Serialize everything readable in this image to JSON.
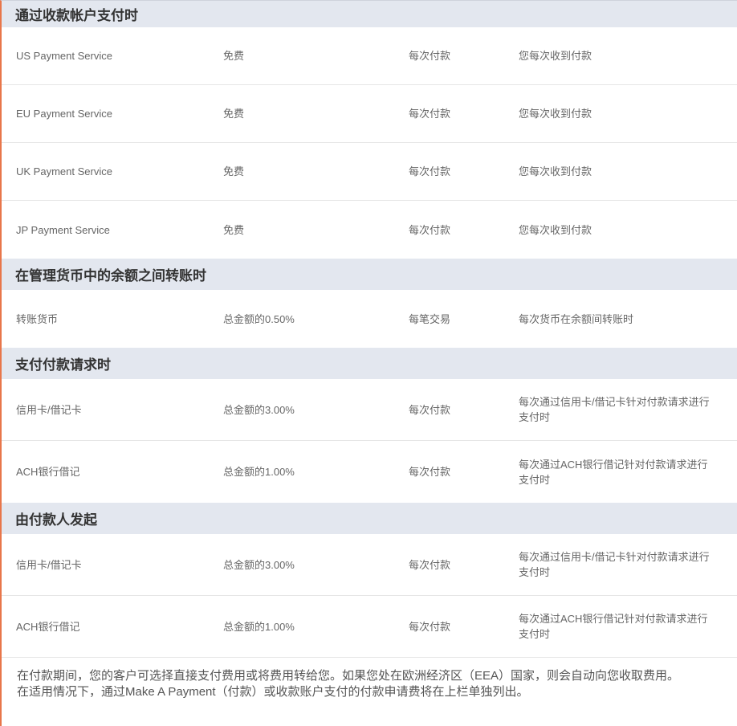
{
  "sections": [
    {
      "title": "通过收款帐户支付时",
      "rows": [
        {
          "service": "US Payment Service",
          "fee": "免费",
          "unit": "每次付款",
          "note": "您每次收到付款"
        },
        {
          "service": "EU Payment Service",
          "fee": "免费",
          "unit": "每次付款",
          "note": "您每次收到付款"
        },
        {
          "service": "UK Payment Service",
          "fee": "免费",
          "unit": "每次付款",
          "note": "您每次收到付款"
        },
        {
          "service": "JP Payment Service",
          "fee": "免费",
          "unit": "每次付款",
          "note": "您每次收到付款"
        }
      ]
    },
    {
      "title": "在管理货币中的余额之间转账时",
      "rows": [
        {
          "service": "转账货币",
          "fee": "总金额的0.50%",
          "unit": "每笔交易",
          "note": "每次货币在余额间转账时"
        }
      ]
    },
    {
      "title": "支付付款请求时",
      "rows": [
        {
          "service": "信用卡/借记卡",
          "fee": "总金额的3.00%",
          "unit": "每次付款",
          "note": "每次通过信用卡/借记卡针对付款请求进行支付时"
        },
        {
          "service": "ACH银行借记",
          "fee": "总金额的1.00%",
          "unit": "每次付款",
          "note": "每次通过ACH银行借记针对付款请求进行支付时"
        }
      ]
    },
    {
      "title": "由付款人发起",
      "rows": [
        {
          "service": "信用卡/借记卡",
          "fee": "总金额的3.00%",
          "unit": "每次付款",
          "note": "每次通过信用卡/借记卡针对付款请求进行支付时"
        },
        {
          "service": "ACH银行借记",
          "fee": "总金额的1.00%",
          "unit": "每次付款",
          "note": "每次通过ACH银行借记针对付款请求进行支付时"
        }
      ]
    }
  ],
  "footer": {
    "line1": "在付款期间，您的客户可选择直接支付费用或将费用转给您。如果您处在欧洲经济区（EEA）国家，则会自动向您收取费用。",
    "line2": "在适用情况下，通过Make A Payment（付款）或收款账户支付的付款申请费将在上栏单独列出。"
  }
}
